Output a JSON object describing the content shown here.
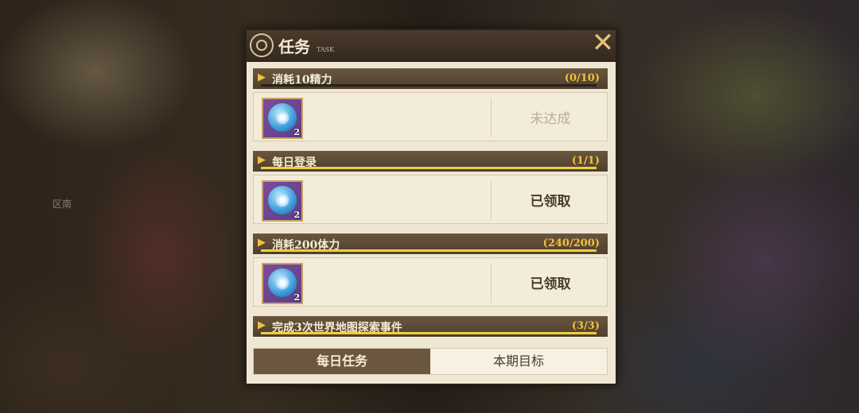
{
  "background": {
    "side_label": "区南"
  },
  "panel": {
    "title": "任务",
    "title_sub": "TASK",
    "close_icon": "close-x-icon",
    "accent_color": "#f0cf3c"
  },
  "tasks": [
    {
      "name": "消耗10精力",
      "count": "(0/10)",
      "progress": 0,
      "reward_qty": "2",
      "status": "未达成",
      "state": "pending"
    },
    {
      "name": "每日登录",
      "count": "(1/1)",
      "progress": 1,
      "reward_qty": "2",
      "status": "已领取",
      "state": "claimed"
    },
    {
      "name": "消耗200体力",
      "count": "(240/200)",
      "progress": 1,
      "reward_qty": "2",
      "status": "已领取",
      "state": "claimed"
    },
    {
      "name": "完成3次世界地图探索事件",
      "count": "(3/3)",
      "progress": 1
    }
  ],
  "tabs": [
    {
      "label": "每日任务",
      "active": true
    },
    {
      "label": "本期目标",
      "active": false
    }
  ]
}
